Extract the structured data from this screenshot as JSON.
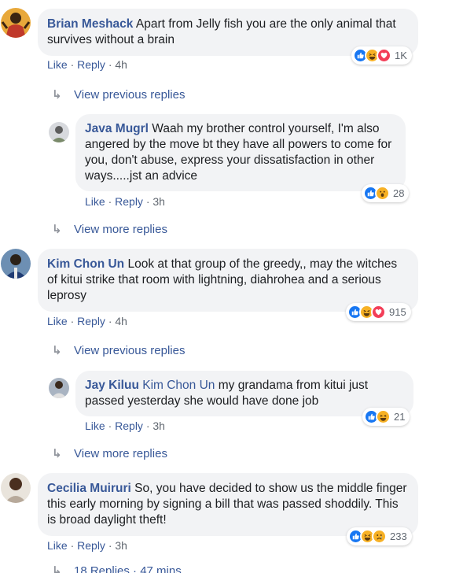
{
  "comments": [
    {
      "author": "Brian Meshack",
      "text": "Apart from Jelly fish you are the only animal that survives without a brain",
      "actions": {
        "like": "Like",
        "reply": "Reply",
        "time": "4h"
      },
      "reactions": {
        "icons": [
          "like",
          "haha",
          "love"
        ],
        "count": "1K"
      },
      "thread_link": "View previous replies",
      "reply": {
        "author": "Java Mugrl",
        "text": "Waah my brother control yourself, I'm also angered by the move bt they have all powers to come for you, don't abuse, express your dissatisfaction in other ways.....jst an advice",
        "actions": {
          "like": "Like",
          "reply": "Reply",
          "time": "3h"
        },
        "reactions": {
          "icons": [
            "like",
            "wow"
          ],
          "count": "28"
        }
      },
      "after_link": "View more replies"
    },
    {
      "author": "Kim Chon Un",
      "text": "Look at that group of the greedy,, may the witches of kitui strike that room with lightning, diahrohea and a serious leprosy",
      "actions": {
        "like": "Like",
        "reply": "Reply",
        "time": "4h"
      },
      "reactions": {
        "icons": [
          "like",
          "haha",
          "love"
        ],
        "count": "915"
      },
      "thread_link": "View previous replies",
      "reply": {
        "author": "Jay Kiluu",
        "mention": "Kim Chon Un",
        "text": "my grandama from kitui just passed yesterday she would have done job",
        "actions": {
          "like": "Like",
          "reply": "Reply",
          "time": "3h"
        },
        "reactions": {
          "icons": [
            "like",
            "haha"
          ],
          "count": "21"
        }
      },
      "after_link": "View more replies"
    },
    {
      "author": "Cecilia Muiruri",
      "text": "So, you have decided to show us the middle finger this early morning by signing a bill that was passed shoddily. This is broad daylight theft!",
      "actions": {
        "like": "Like",
        "reply": "Reply",
        "time": "3h"
      },
      "reactions": {
        "icons": [
          "like",
          "haha",
          "sad"
        ],
        "count": "233"
      },
      "footer_link": "18 Replies · 47 mins"
    }
  ],
  "colors": {
    "link": "#385898",
    "bubble": "#f2f3f5",
    "meta": "#606770",
    "like": "#1877f2",
    "love": "#f33e58",
    "haha": "#f7b125"
  }
}
